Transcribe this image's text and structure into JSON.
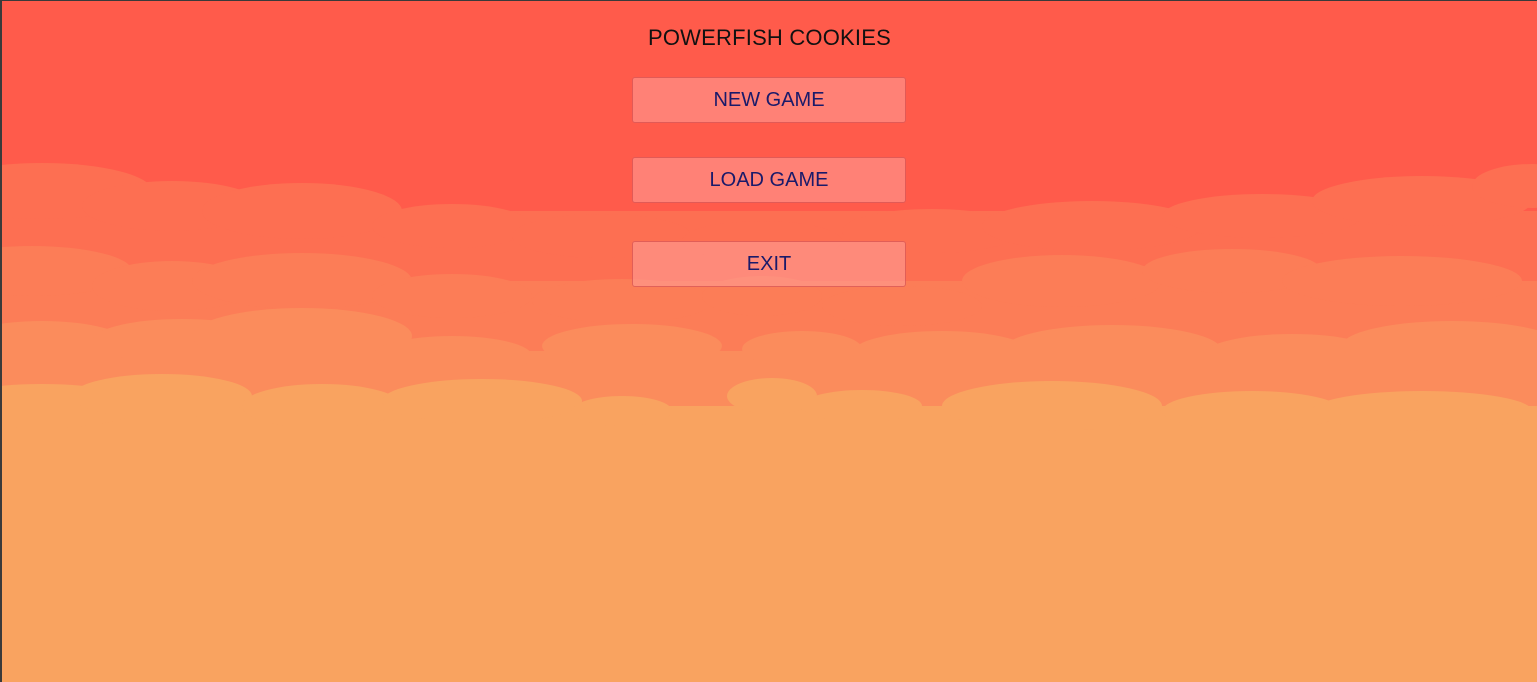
{
  "game": {
    "title": "POWERFISH COOKIES"
  },
  "menu": {
    "new_game_label": "NEW GAME",
    "load_game_label": "LOAD GAME",
    "exit_label": "EXIT"
  },
  "colors": {
    "sky_top": "#ff5b4b",
    "cloud_layer_1": "#fd6f52",
    "cloud_layer_2": "#fc7d57",
    "cloud_layer_3": "#fb8c5c",
    "cloud_layer_4": "#f9a360",
    "title_text": "#111111",
    "button_text": "#1a1a6a"
  }
}
